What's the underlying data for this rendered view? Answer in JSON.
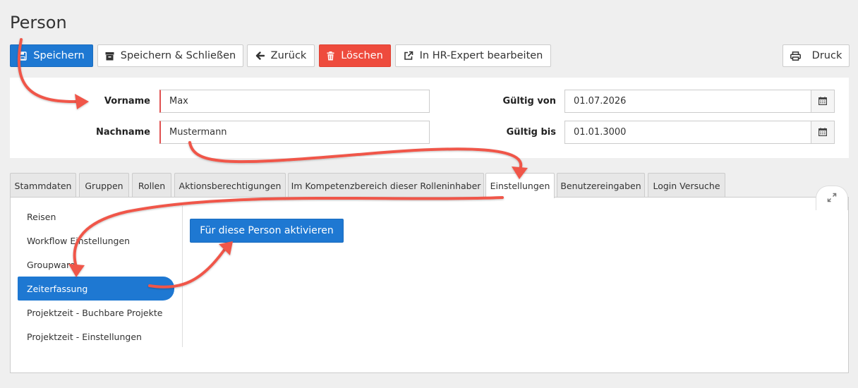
{
  "page": {
    "title": "Person"
  },
  "toolbar": {
    "save_label": "Speichern",
    "save_close_label": "Speichern & Schließen",
    "back_label": "Zurück",
    "delete_label": "Löschen",
    "hr_expert_label": "In HR-Expert bearbeiten",
    "print_label": "Druck"
  },
  "form": {
    "first_name_label": "Vorname",
    "first_name_value": "Max",
    "last_name_label": "Nachname",
    "last_name_value": "Mustermann",
    "valid_from_label": "Gültig von",
    "valid_from_value": "01.07.2026",
    "valid_to_label": "Gültig bis",
    "valid_to_value": "01.01.3000"
  },
  "tabs": [
    {
      "label": "Stammdaten",
      "active": false
    },
    {
      "label": "Gruppen",
      "active": false
    },
    {
      "label": "Rollen",
      "active": false
    },
    {
      "label": "Aktionsberechtigungen",
      "active": false
    },
    {
      "label": "Im Kompetenzbereich dieser Rolleninhaber",
      "active": false
    },
    {
      "label": "Einstellungen",
      "active": true
    },
    {
      "label": "Benutzereingaben",
      "active": false
    },
    {
      "label": "Login Versuche",
      "active": false
    }
  ],
  "sidebar": {
    "items": [
      {
        "label": "Reisen",
        "active": false
      },
      {
        "label": "Workflow Einstellungen",
        "active": false
      },
      {
        "label": "Groupware",
        "active": false
      },
      {
        "label": "Zeiterfassung",
        "active": true
      },
      {
        "label": "Projektzeit - Buchbare Projekte",
        "active": false
      },
      {
        "label": "Projektzeit - Einstellungen",
        "active": false
      }
    ]
  },
  "main": {
    "activate_label": "Für diese Person aktivieren"
  },
  "colors": {
    "primary": "#1e78d2",
    "danger": "#ee4b3d",
    "annotation_arrow": "#f0564a",
    "required_marker": "#e05050"
  },
  "icons": {
    "save": "floppy-disk-icon",
    "save_close": "archive-box-icon",
    "back": "arrow-left-icon",
    "delete": "trash-icon",
    "external": "external-link-icon",
    "print": "printer-icon",
    "calendar": "calendar-icon",
    "expand": "expand-icon"
  }
}
